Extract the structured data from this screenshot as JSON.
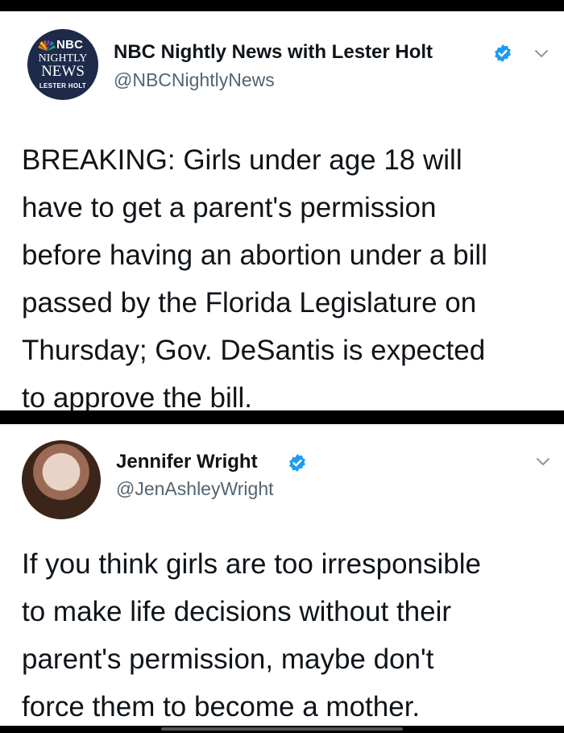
{
  "tweets": [
    {
      "name": "NBC Nightly News with Lester Holt",
      "handle": "@NBCNightlyNews",
      "avatar": {
        "brand": "NBC",
        "line1": "NIGHTLY",
        "line2": "NEWS",
        "line3": "LESTER HOLT"
      },
      "verified": true,
      "text": "BREAKING: Girls under age 18 will\nhave to get a parent's permission\nbefore having an abortion under a bill\npassed by the Florida Legislature on\nThursday; Gov. DeSantis is expected\nto approve the bill."
    },
    {
      "name": "Jennifer Wright",
      "handle": "@JenAshleyWright",
      "verified": true,
      "text": "If you think girls are too irresponsible\nto make life decisions without their\nparent's permission, maybe don't\nforce them to become a mother."
    }
  ],
  "icons": {
    "verified": "verified-badge-icon",
    "menu": "chevron-down-icon"
  },
  "colors": {
    "verified": "#1d9bf0",
    "nbc_avatar": "#1d2a4a"
  }
}
